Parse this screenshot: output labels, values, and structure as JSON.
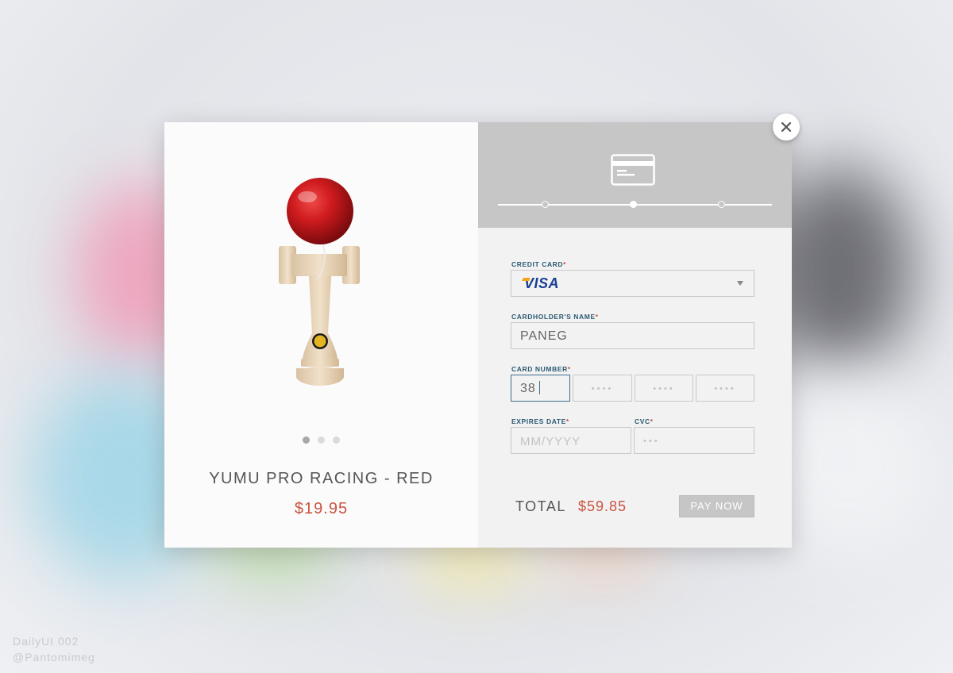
{
  "product": {
    "name": "YUMU PRO RACING - RED",
    "price": "$19.95",
    "carousel": {
      "count": 3,
      "active_index": 1
    }
  },
  "checkout": {
    "steps": {
      "count": 3,
      "active_index": 2
    },
    "credit_card": {
      "label": "CREDIT CARD",
      "selected": "VISA"
    },
    "cardholder": {
      "label": "CARDHOLDER'S NAME",
      "value": "PANEG"
    },
    "card_number": {
      "label": "CARD NUMBER",
      "value": "38",
      "masked": [
        "••••",
        "••••",
        "••••"
      ]
    },
    "expires": {
      "label": "EXPIRES DATE",
      "placeholder": "MM/YYYY"
    },
    "cvc": {
      "label": "CVC",
      "placeholder": "•••"
    },
    "required_mark": "*",
    "total_label": "TOTAL",
    "total_value": "$59.85",
    "pay_button": "PAY NOW"
  },
  "footer": {
    "line1": "DailyUI 002",
    "line2": "@Pantomimeg"
  },
  "colors": {
    "accent_red": "#c9533f",
    "label_blue": "#2b5a74",
    "header_gray": "#c6c6c6"
  }
}
